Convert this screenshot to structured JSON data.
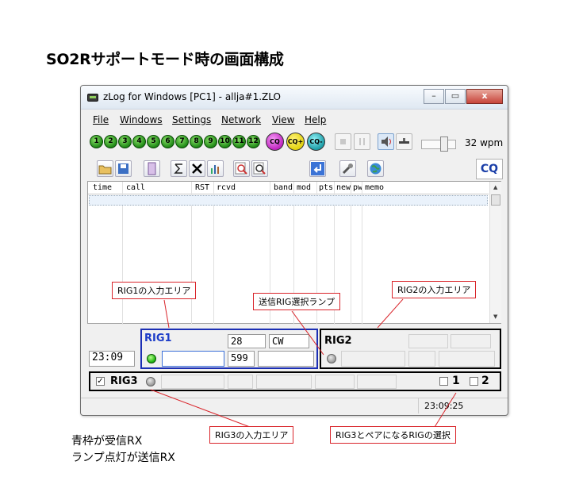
{
  "heading": "SO2Rサポートモード時の画面構成",
  "notes": [
    "青枠が受信RX",
    "ランプ点灯が送信RX"
  ],
  "window": {
    "title": "zLog for Windows  [PC1] - allja#1.ZLO",
    "controls": [
      "–",
      "▭",
      "x"
    ]
  },
  "menu": {
    "file": "File",
    "windows": "Windows",
    "settings": "Settings",
    "network": "Network",
    "view": "View",
    "help": "Help"
  },
  "toolbar": {
    "cw_keys": [
      "1",
      "2",
      "3",
      "4",
      "5",
      "6",
      "7",
      "8",
      "9",
      "10",
      "11",
      "12"
    ],
    "cq_buttons": [
      "CQ",
      "CQ+",
      "CQ-"
    ],
    "wpm": "32 wpm",
    "cq_label": "CQ",
    "colors": {
      "cw_key": "#1f8a16",
      "cq1": "#c026c0",
      "cq2": "#e3d20e",
      "cq3": "#1e9ea8"
    }
  },
  "log_grid": {
    "columns": [
      "time",
      "call",
      "RST",
      "rcvd",
      "band",
      "mod",
      "pts",
      "new",
      "pw",
      "memo"
    ]
  },
  "rig1": {
    "label": "RIG1",
    "band": "28",
    "mode": "CW",
    "time": "23:09",
    "rst": "599"
  },
  "rig2": {
    "label": "RIG2"
  },
  "rig3": {
    "label": "RIG3",
    "checked_mark": "✓",
    "pair1": "1",
    "pair2": "2"
  },
  "status": {
    "clock": "23:09:25"
  },
  "callouts": {
    "rig1_input": "RIG1の入力エリア",
    "tx_lamp": "送信RIG選択ランプ",
    "rig2_input": "RIG2の入力エリア",
    "rig3_input": "RIG3の入力エリア",
    "rig3_pair": "RIG3とペアになるRIGの選択"
  }
}
